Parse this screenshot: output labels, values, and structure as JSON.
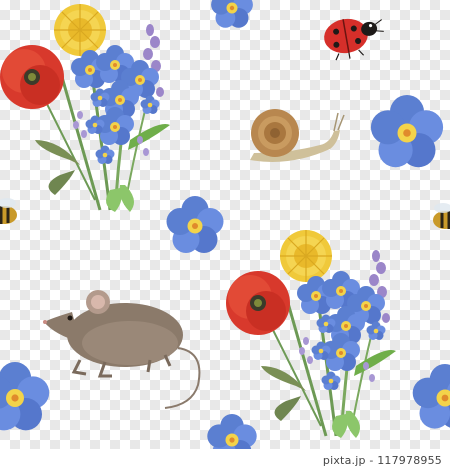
{
  "watermark": {
    "text": "pixta.jp - 117978955"
  },
  "colors": {
    "poppy": "#d8392c",
    "dandelion": "#f0c93a",
    "forget_me_not": "#5b7fd1",
    "lavender": "#9b86c9",
    "stem": "#6d9a55",
    "ladybug": "#d62f2a",
    "snail_shell": "#b8874f",
    "mouse": "#8b7a6a"
  },
  "icons": [
    "bouquet-icon",
    "ladybug-icon",
    "snail-icon",
    "forget-me-not-icon",
    "mouse-icon",
    "bee-icon"
  ]
}
